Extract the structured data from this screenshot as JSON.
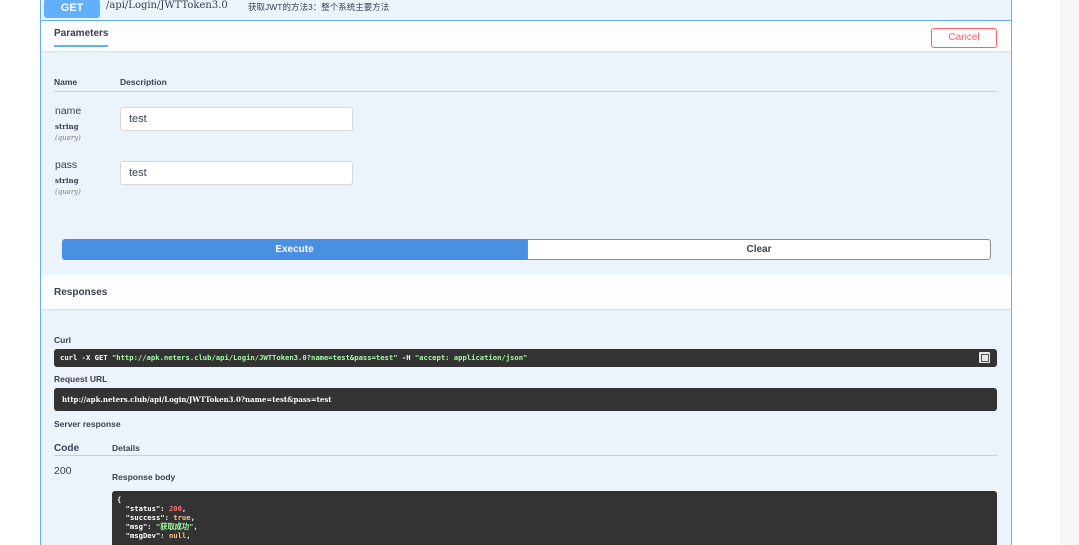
{
  "summary": {
    "method": "GET",
    "path": "/api/Login/JWTToken3.0",
    "description": "获取JWT的方法3：整个系统主要方法"
  },
  "parameters": {
    "tab_label": "Parameters",
    "cancel_label": "Cancel",
    "col_name": "Name",
    "col_description": "Description",
    "items": [
      {
        "name": "name",
        "type": "string",
        "in": "(query)",
        "value": "test"
      },
      {
        "name": "pass",
        "type": "string",
        "in": "(query)",
        "value": "test"
      }
    ]
  },
  "actions": {
    "execute_label": "Execute",
    "clear_label": "Clear"
  },
  "responses": {
    "title": "Responses",
    "curl_label": "Curl",
    "curl_prefix": "curl -X GET ",
    "curl_url": "\"http://apk.neters.club/api/Login/JWTToken3.0?name=test&pass=test\"",
    "curl_mid": " -H  ",
    "curl_header": "\"accept: application/json\"",
    "request_url_label": "Request URL",
    "request_url": "http://apk.neters.club/api/Login/JWTToken3.0?name=test&pass=test",
    "server_response_label": "Server response",
    "code_header": "Code",
    "details_header": "Details",
    "code": "200",
    "response_body_label": "Response body",
    "body": {
      "open": "{",
      "status_key": "\"status\"",
      "status_val": "200",
      "success_key": "\"success\"",
      "success_val": "true",
      "msg_key": "\"msg\"",
      "msg_val": "\"获取成功\"",
      "msgDev_key": "\"msgDev\"",
      "msgDev_val": "null"
    }
  }
}
